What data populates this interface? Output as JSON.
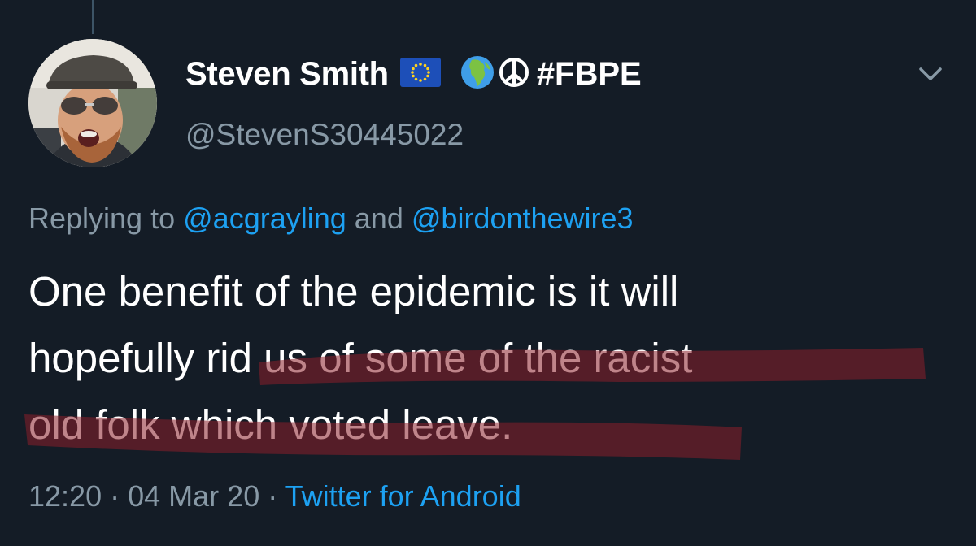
{
  "tweet": {
    "display_name": "Steven Smith",
    "name_emojis": [
      {
        "icon": "eu-flag-icon"
      },
      {
        "icon": "globe-africa-icon"
      },
      {
        "icon": "peace-sign-icon"
      }
    ],
    "name_hashtag": "#FBPE",
    "handle": "@StevenS30445022",
    "reply": {
      "prefix": "Replying to",
      "mention_1": "@acgrayling",
      "conjunction": "and",
      "mention_2": "@birdonthewire3"
    },
    "text": {
      "line1": "One benefit of the epidemic is it will",
      "line2_plain": "hopefully ",
      "line2_highlighted": "rid us of some of the racist",
      "line3_highlighted": "old folk which voted leave."
    },
    "highlight_color": "#8b1f2a",
    "meta": {
      "time": "12:20",
      "separator": "·",
      "date": "04 Mar 20",
      "source": "Twitter for Android"
    }
  },
  "colors": {
    "background": "#141c26",
    "text_primary": "#ffffff",
    "text_secondary": "#8899a6",
    "link": "#1da1f2"
  }
}
